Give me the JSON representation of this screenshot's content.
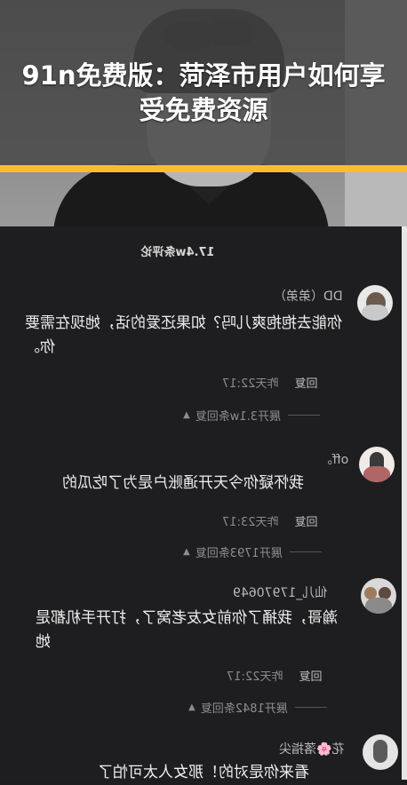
{
  "headline": "91n免费版：菏泽市用户如何享受免费资源",
  "comment_count": "17.4w条评论",
  "comments": [
    {
      "user": "DD（弟弟）",
      "text": "你能去抱抱爽儿吗？如果还爱的话，她现在需要你。",
      "time": "昨天22:17",
      "reply_label": "回复",
      "expand": "展开3.1w条回复"
    },
    {
      "user": "off。",
      "text": "我怀疑你今天开通账户是为了吃瓜的",
      "time": "昨天23:17",
      "reply_label": "回复",
      "expand": "展开1793条回复"
    },
    {
      "user": "仙儿_17970649",
      "text": "瀚哥，我捅了你前女友老窝了，打开手机都是她",
      "time": "昨天22:17",
      "reply_label": "回复",
      "expand": "展开1842条回复"
    },
    {
      "user": "花🌸落指尖",
      "text": "看来你是对的！那女人太可怕了"
    }
  ],
  "colors": {
    "accent_bar": "#f2c12e",
    "panel_bg": "#1e1e20"
  }
}
